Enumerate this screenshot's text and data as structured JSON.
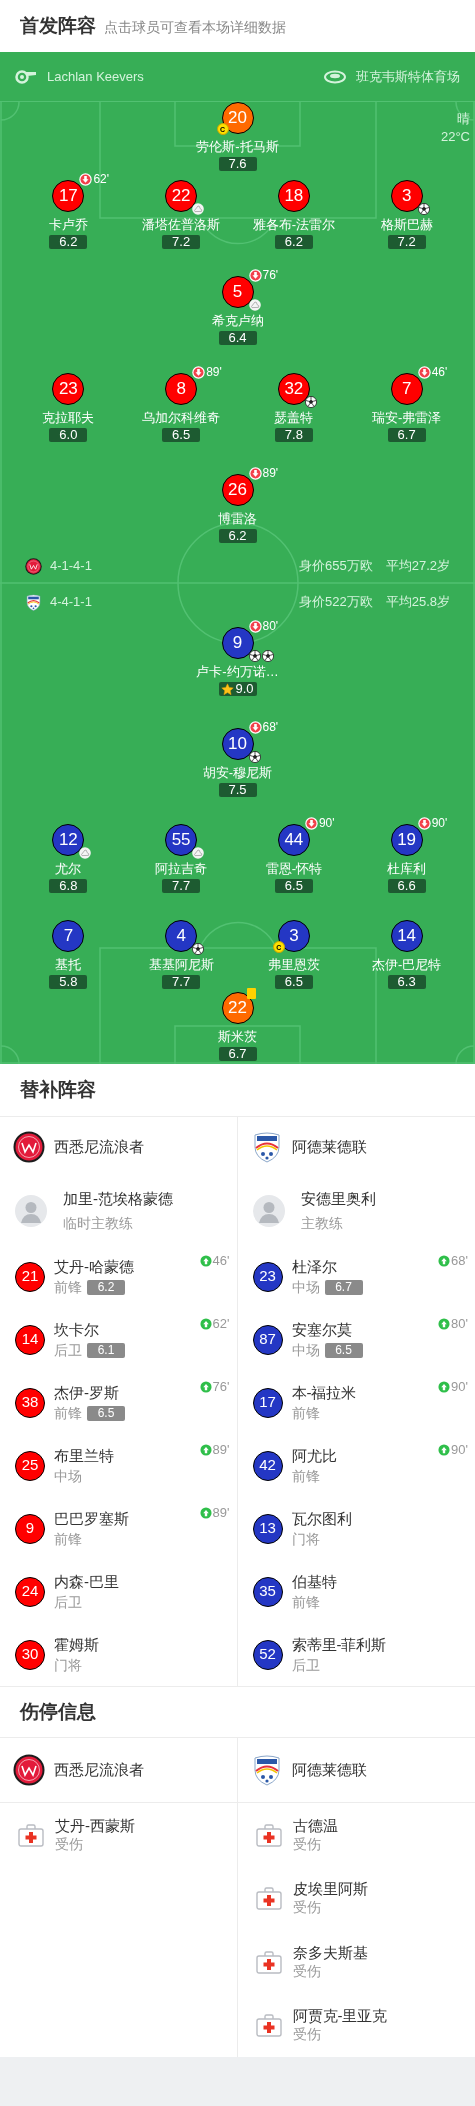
{
  "header": {
    "title": "首发阵容",
    "subtitle": "点击球员可查看本场详细数据"
  },
  "match_info": {
    "referee": "Lachlan Keevers",
    "venue": "班克韦斯特体育场",
    "weather": "晴",
    "temperature": "22°C"
  },
  "lineup": {
    "teams": [
      {
        "kind": "roundel",
        "color": "#ff0000",
        "formation": "4-1-4-1",
        "value": "身价655万欧",
        "avg_age": "平均27.2岁",
        "rows": [
          {
            "players": [
              {
                "number": "20",
                "name": "劳伦斯-托马斯",
                "rating": "7.6",
                "kind": "goalkeeper",
                "captain_badge": "C"
              }
            ]
          },
          {
            "players": [
              {
                "number": "17",
                "name": "卡卢乔",
                "rating": "6.2",
                "kind": "outfield",
                "sub_off": "62'"
              },
              {
                "number": "22",
                "name": "潘塔佐普洛斯",
                "rating": "7.2",
                "kind": "outfield",
                "events": [
                  {
                    "kind": "assist"
                  }
                ]
              },
              {
                "number": "18",
                "name": "雅各布-法雷尔",
                "rating": "6.2",
                "kind": "outfield"
              },
              {
                "number": "3",
                "name": "格斯巴赫",
                "rating": "7.2",
                "kind": "outfield",
                "events": [
                  {
                    "kind": "goal"
                  }
                ]
              }
            ]
          },
          {
            "players": [
              {
                "number": "5",
                "name": "希克卢纳",
                "rating": "6.4",
                "kind": "outfield",
                "sub_off": "76'",
                "events": [
                  {
                    "kind": "assist"
                  }
                ]
              }
            ]
          },
          {
            "players": [
              {
                "number": "23",
                "name": "克拉耶夫",
                "rating": "6.0",
                "kind": "outfield"
              },
              {
                "number": "8",
                "name": "乌加尔科维奇",
                "rating": "6.5",
                "kind": "outfield",
                "sub_off": "89'"
              },
              {
                "number": "32",
                "name": "瑟盖特",
                "rating": "7.8",
                "kind": "outfield",
                "events": [
                  {
                    "kind": "goal"
                  }
                ]
              },
              {
                "number": "7",
                "name": "瑞安-弗雷泽",
                "rating": "6.7",
                "kind": "outfield",
                "sub_off": "46'"
              }
            ]
          },
          {
            "players": [
              {
                "number": "26",
                "name": "博雷洛",
                "rating": "6.2",
                "kind": "outfield",
                "sub_off": "89'"
              }
            ]
          }
        ]
      },
      {
        "kind": "shield",
        "color": "#2437c4",
        "formation": "4-4-1-1",
        "value": "身价522万欧",
        "avg_age": "平均25.8岁",
        "rows": [
          {
            "players": [
              {
                "number": "9",
                "name": "卢卡-约万诺…",
                "rating": "9.0",
                "kind": "outfield",
                "sub_off": "80'",
                "motm": true,
                "events": [
                  {
                    "kind": "goal"
                  },
                  {
                    "kind": "goal"
                  }
                ]
              }
            ]
          },
          {
            "players": [
              {
                "number": "10",
                "name": "胡安-穆尼斯",
                "rating": "7.5",
                "kind": "outfield",
                "sub_off": "68'",
                "events": [
                  {
                    "kind": "goal"
                  }
                ]
              }
            ]
          },
          {
            "players": [
              {
                "number": "12",
                "name": "尤尔",
                "rating": "6.8",
                "kind": "outfield",
                "events": [
                  {
                    "kind": "assist"
                  }
                ]
              },
              {
                "number": "55",
                "name": "阿拉吉奇",
                "rating": "7.7",
                "kind": "outfield",
                "events": [
                  {
                    "kind": "assist"
                  }
                ]
              },
              {
                "number": "44",
                "name": "雷恩-怀特",
                "rating": "6.5",
                "kind": "outfield",
                "sub_off": "90'"
              },
              {
                "number": "19",
                "name": "杜库利",
                "rating": "6.6",
                "kind": "outfield",
                "sub_off": "90'"
              }
            ]
          },
          {
            "players": [
              {
                "number": "7",
                "name": "基托",
                "rating": "5.8",
                "kind": "outfield"
              },
              {
                "number": "4",
                "name": "基基阿尼斯",
                "rating": "7.7",
                "kind": "outfield",
                "events": [
                  {
                    "kind": "goal"
                  }
                ]
              },
              {
                "number": "3",
                "name": "弗里恩茨",
                "rating": "6.5",
                "kind": "outfield",
                "captain_badge": "C"
              },
              {
                "number": "14",
                "name": "杰伊-巴尼特",
                "rating": "6.3",
                "kind": "outfield"
              }
            ]
          },
          {
            "players": [
              {
                "number": "22",
                "name": "斯米茨",
                "rating": "6.7",
                "kind": "goalkeeper",
                "events": [
                  {
                    "kind": "yellow_card"
                  }
                ]
              }
            ]
          }
        ]
      }
    ]
  },
  "substitutes": {
    "title": "替补阵容",
    "teams": [
      {
        "name": "西悉尼流浪者",
        "coach": {
          "name": "加里-范埃格蒙德",
          "role": "临时主教练"
        },
        "players": [
          {
            "number": "21",
            "name": "艾丹-哈蒙德",
            "position": "前锋",
            "rating": "6.2",
            "sub_on": "46'"
          },
          {
            "number": "14",
            "name": "坎卡尔",
            "position": "后卫",
            "rating": "6.1",
            "sub_on": "62'"
          },
          {
            "number": "38",
            "name": "杰伊-罗斯",
            "position": "前锋",
            "rating": "6.5",
            "sub_on": "76'"
          },
          {
            "number": "25",
            "name": "布里兰特",
            "position": "中场",
            "sub_on": "89'"
          },
          {
            "number": "9",
            "name": "巴巴罗塞斯",
            "position": "前锋",
            "sub_on": "89'"
          },
          {
            "number": "24",
            "name": "内森-巴里",
            "position": "后卫"
          },
          {
            "number": "30",
            "name": "霍姆斯",
            "position": "门将"
          }
        ]
      },
      {
        "name": "阿德莱德联",
        "coach": {
          "name": "安德里奥利",
          "role": "主教练"
        },
        "players": [
          {
            "number": "23",
            "name": "杜泽尔",
            "position": "中场",
            "rating": "6.7",
            "sub_on": "68'"
          },
          {
            "number": "87",
            "name": "安塞尔莫",
            "position": "中场",
            "rating": "6.5",
            "sub_on": "80'"
          },
          {
            "number": "17",
            "name": "本-福拉米",
            "position": "前锋",
            "sub_on": "90'"
          },
          {
            "number": "42",
            "name": "阿尤比",
            "position": "前锋",
            "sub_on": "90'"
          },
          {
            "number": "13",
            "name": "瓦尔图利",
            "position": "门将"
          },
          {
            "number": "35",
            "name": "伯基特",
            "position": "前锋"
          },
          {
            "number": "52",
            "name": "索蒂里-菲利斯",
            "position": "后卫"
          }
        ]
      }
    ]
  },
  "injuries": {
    "title": "伤停信息",
    "teams": [
      {
        "name": "西悉尼流浪者",
        "players": [
          {
            "name": "艾丹-西蒙斯",
            "status": "受伤"
          }
        ]
      },
      {
        "name": "阿德莱德联",
        "players": [
          {
            "name": "古德温",
            "status": "受伤"
          },
          {
            "name": "皮埃里阿斯",
            "status": "受伤"
          },
          {
            "name": "奈多夫斯基",
            "status": "受伤"
          },
          {
            "name": "阿贾克-里亚克",
            "status": "受伤"
          }
        ]
      }
    ]
  }
}
